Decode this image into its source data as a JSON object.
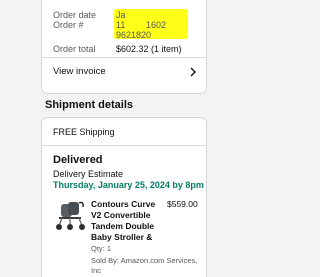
{
  "order_summary": {
    "date_label": "Order date",
    "date_value": "Ja",
    "number_label": "Order #",
    "number_value_start": "11",
    "number_value_mid": "1602",
    "number_value_end": "9621820",
    "total_label": "Order total",
    "total_value": "$602.32 (1 item)",
    "view_invoice": "View invoice",
    "redaction_color": "#ffff1a"
  },
  "shipment": {
    "heading": "Shipment details",
    "shipping_method": "FREE Shipping",
    "status": "Delivered",
    "estimate_label": "Delivery Estimate",
    "estimate_date": "Thursday, January 25, 2024 by 8pm",
    "status_color": "#067d62",
    "item": {
      "name_lines": [
        "Contours Curve",
        "V2 Convertible",
        "Tandem Double",
        "Baby Stroller &"
      ],
      "price": "$559.00",
      "qty": "Qty: 1",
      "sold_by": "Sold By: Amazon.com Services,",
      "sold_by_cont": "Inc",
      "thumbnail": "stroller-image"
    }
  },
  "icons": {
    "invoice_chevron": "chevron-right-icon"
  }
}
